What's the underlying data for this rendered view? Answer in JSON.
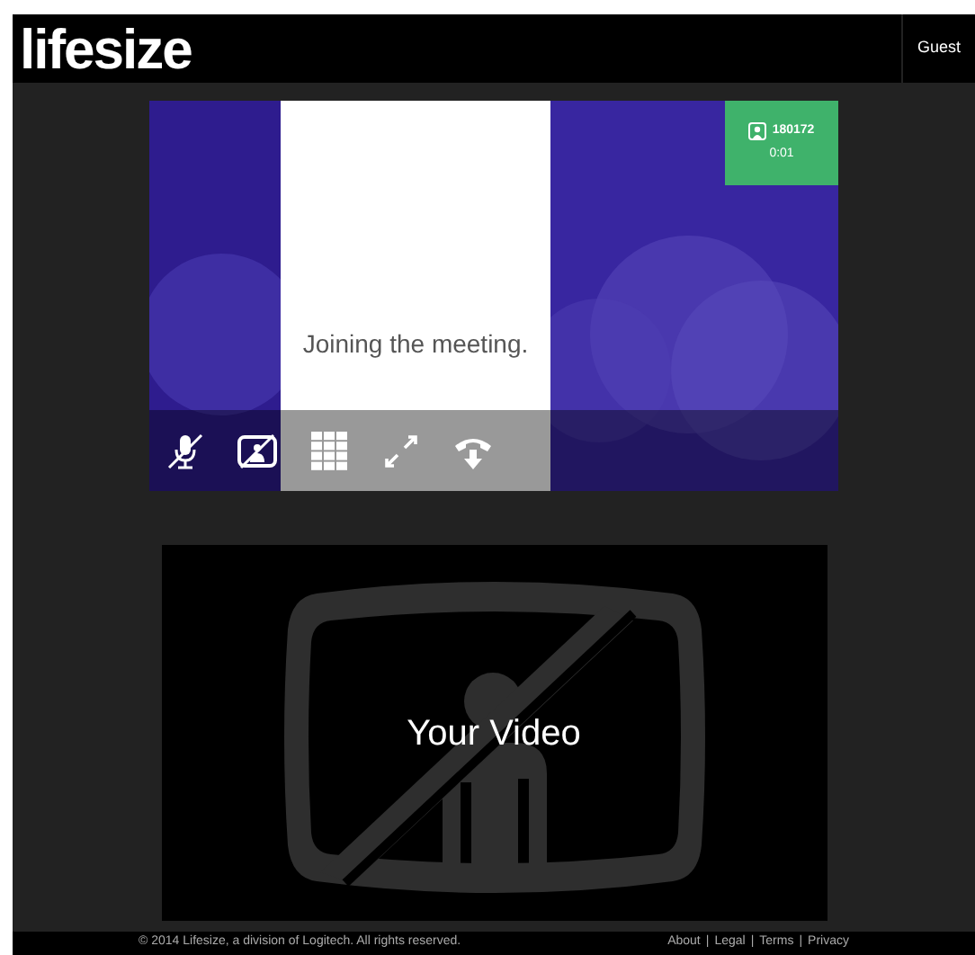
{
  "header": {
    "logo": "lifesize",
    "user": "Guest"
  },
  "call": {
    "meeting_id": "180172",
    "duration": "0:01",
    "message": "Joining the meeting.",
    "controls": [
      {
        "kind": "mic",
        "muted": true
      },
      {
        "kind": "camera",
        "muted": true
      },
      {
        "kind": "keypad"
      },
      {
        "kind": "fullscreen"
      },
      {
        "kind": "hangup"
      }
    ]
  },
  "self_view": {
    "label": "Your Video"
  },
  "footer": {
    "copyright": "© 2014 Lifesize, a division of Logitech. All rights reserved.",
    "links": [
      "About",
      "Legal",
      "Terms",
      "Privacy"
    ],
    "separator": "|"
  }
}
